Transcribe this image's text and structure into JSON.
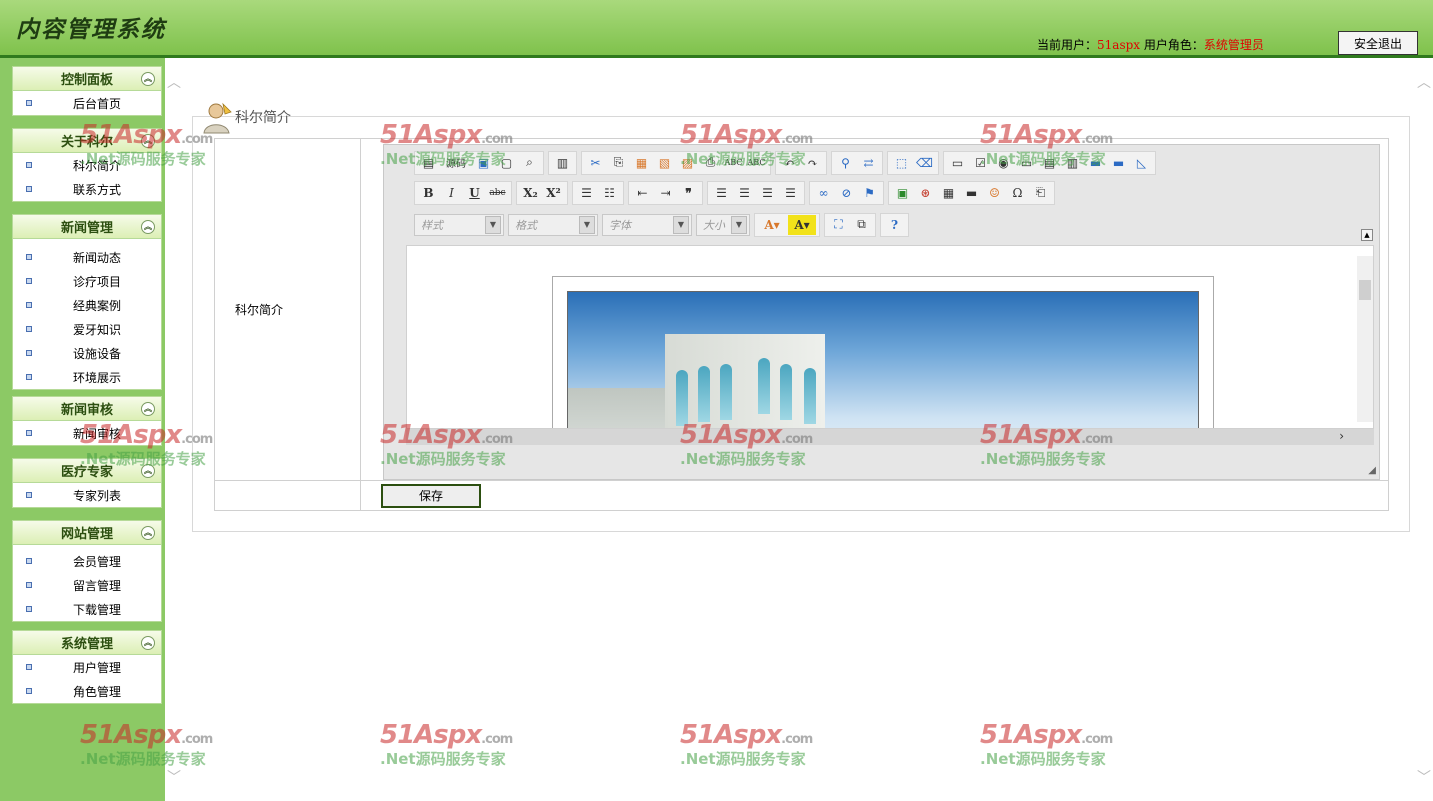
{
  "header": {
    "title": "内容管理系统",
    "user_label": "当前用户：",
    "user_name": "51aspx",
    "role_label": "用户角色：",
    "role_name": "系统管理员",
    "logout_label": "安全退出"
  },
  "sidebar": {
    "panels": [
      {
        "title": "控制面板",
        "items": [
          "后台首页"
        ]
      },
      {
        "title": "关于科尔",
        "items": [
          "科尔简介",
          "联系方式"
        ]
      },
      {
        "title": "新闻管理",
        "items": [
          "新闻动态",
          "诊疗项目",
          "经典案例",
          "爱牙知识",
          "设施设备",
          "环境展示"
        ]
      },
      {
        "title": "新闻审核",
        "items": [
          "新闻审核"
        ]
      },
      {
        "title": "医疗专家",
        "items": [
          "专家列表"
        ]
      },
      {
        "title": "网站管理",
        "items": [
          "会员管理",
          "留言管理",
          "下载管理"
        ]
      },
      {
        "title": "系统管理",
        "items": [
          "用户管理",
          "角色管理"
        ]
      }
    ]
  },
  "main": {
    "section_title": "科尔简介",
    "field_label": "科尔简介",
    "save_label": "保存",
    "editor": {
      "source_label": "源码",
      "style_placeholder": "样式",
      "format_placeholder": "格式",
      "font_placeholder": "字体",
      "size_placeholder": "大小"
    }
  },
  "watermark": {
    "brand": "51Aspx",
    "domain": ".com",
    "tagline": ".Net源码服务专家"
  }
}
